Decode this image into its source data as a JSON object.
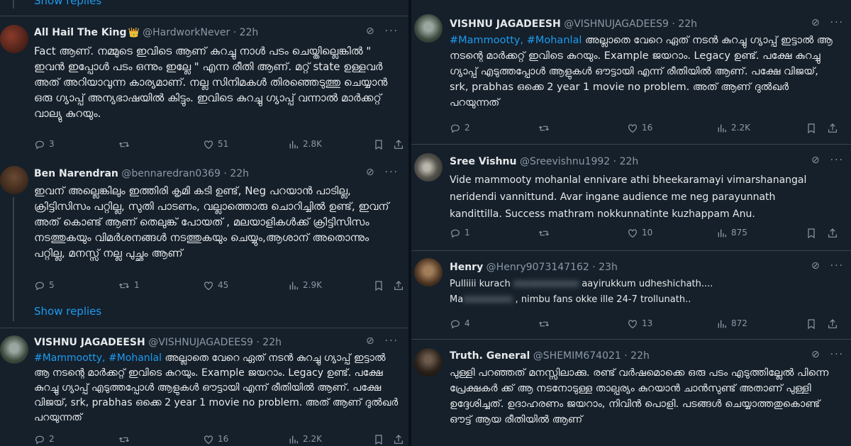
{
  "left": {
    "show_replies_top": "Show replies",
    "tweets": [
      {
        "name": "All Hail The King",
        "badge": "👑",
        "handle": "@HardworkNever",
        "time": "22h",
        "text": "Fact ആണ്. നമ്മുടെ ഇവിടെ ആണ് കുറച്ചു നാൾ പടം ചെയ്തില്ലെങ്കിൽ \" ഇവൻ ഇപ്പോൾ പടം ഒന്നും ഇല്ലേ \" എന്ന രീതി ആണ്. മറ്റ് state ഉള്ളവർ അത് അറിയാവുന്ന കാര്യമാണ്. നല്ല സിനിമകൾ തിരഞ്ഞെടുത്തു ചെയ്യാൻ ഒരു ഗ്യാപ്പ് അന്യഭാഷയിൽ കിട്ടും. ഇവിടെ കുറച്ചു ഗ്യാപ്പ് വന്നാൽ മാർക്കറ്റ് വാല്യു കുറയും.",
        "replies": "3",
        "retweets": "",
        "likes": "51",
        "views": "2.8K"
      },
      {
        "name": "Ben Narendran",
        "handle": "@bennaredran0369",
        "time": "22h",
        "text": "ഇവന് അല്ലെങ്കിലും ഇത്തിരി കൃമി കടി ഉണ്ട്, Neg പറയാൻ പാടില്ല, ക്രിട്ടിസിസം പറ്റില്ല, സുതി പാടണം, വല്ലാത്തൊരു ചൊറിച്ചിൽ ഉണ്ട്, ഇവന് അത് കൊണ്ട് ആണ് തെലുങ്ക് പോയത് , മലയാളികൾക്ക് ക്രിട്ടിസിസം നടത്തുകയും വിമർശനങ്ങൾ നടത്തുകയും ചെയ്യും,ആശാന് അതൊന്നും പറ്റില്ല, മനസ്സ് നല്ല പുച്ഛം ആണ്",
        "replies": "5",
        "retweets": "1",
        "likes": "45",
        "views": "2.9K"
      }
    ],
    "show_replies_bottom": "Show replies",
    "tweet3": {
      "name": "VISHNU JAGADEESH",
      "handle": "@VISHNUJAGADEES9",
      "time": "22h",
      "hashtags": "#Mammootty, #Mohanlal",
      "text": " അല്ലാതെ വേറെ ഏത് നടൻ കുറച്ചു ഗ്യാപ്പ് ഇട്ടാൽ ആ നടന്റെ മാർക്കറ്റ് ഇവിടെ കുറയും. Example ജയറാം. Legacy ഉണ്ട്. പക്ഷേ കുറച്ചു ഗ്യാപ്പ് എടുത്തപ്പോൾ ആളുകൾ ഔട്ടായി എന്ന് രീതിയിൽ ആണ്. പക്ഷേ വിജയ്, srk, prabhas ഒക്കെ 2 year 1 movie no problem. അത് ആണ് ദുൽഖർ പറയുന്നത്",
      "replies": "2",
      "retweets": "",
      "likes": "16",
      "views": "2.2K"
    }
  },
  "right": {
    "tweets": [
      {
        "name": "VISHNU JAGADEESH",
        "handle": "@VISHNUJAGADEES9",
        "time": "22h",
        "hashtags": "#Mammootty, #Mohanlal",
        "text": " അല്ലാതെ വേറെ ഏത് നടൻ കുറച്ചു ഗ്യാപ്പ് ഇട്ടാൽ ആ നടന്റെ മാർക്കറ്റ് ഇവിടെ കുറയും. Example ജയറാം. Legacy ഉണ്ട്. പക്ഷേ കുറച്ചു ഗ്യാപ്പ് എടുത്തപ്പോൾ ആളുകൾ ഔട്ടായി എന്ന് രീതിയിൽ ആണ്. പക്ഷേ വിജയ്, srk, prabhas ഒക്കെ 2 year 1 movie no problem. അത് ആണ് ദുൽഖർ പറയുന്നത്",
        "replies": "2",
        "retweets": "",
        "likes": "16",
        "views": "2.2K"
      },
      {
        "name": "Sree Vishnu",
        "handle": "@Sreevishnu1992",
        "time": "22h",
        "text": "Vide mammooty mohanlal ennivare athi bheekaramayi vimarshanangal neridendi vannittund. Avar ingane audience me neg parayunnath kandittilla. Success mathram nokkunnatinte kuzhappam Anu.",
        "replies": "1",
        "retweets": "",
        "likes": "10",
        "views": "875"
      },
      {
        "name": "Henry",
        "handle": "@Henry9073147162",
        "time": "23h",
        "text_a": "Pulliiii kurach",
        "text_blur1": "xxxxxxxxxxxx",
        "text_b": "aayirukkum udheshichath....",
        "text_c": "Ma",
        "text_blur2": "xxxxxxxxx",
        "text_d": ", nimbu fans okke ille 24-7 trollunath..",
        "replies": "4",
        "retweets": "",
        "likes": "13",
        "views": "872"
      },
      {
        "name": "Truth. General",
        "handle": "@SHEMIM674021",
        "time": "22h",
        "text": "പുള്ളി പറഞ്ഞത് മനസ്സിലാക്കു. രണ്ട് വർഷമൊക്കെ ഒരു പടം എടുത്തില്ലേൽ പിന്നെ പ്രേക്ഷകർ ക്ക് ആ നടനോടുള്ള താല്പര്യം കുറയാൻ ചാൻസുണ്ട് അതാണ് പുള്ളി ഉദ്ദേശിച്ചത്. ഉദാഹരണം ജയറാം, നിവിൻ പൊളി. പടങ്ങൾ ചെയ്യാത്തതുകൊണ്ട് ഔട്ട് ആയ രീതിയിൽ ആണ്"
      }
    ]
  },
  "icons": {
    "reply": "reply-icon",
    "retweet": "retweet-icon",
    "like": "heart-icon",
    "views": "views-icon",
    "bookmark": "bookmark-icon",
    "share": "share-icon",
    "grok": "grok-icon",
    "more": "more-icon"
  },
  "colors": {
    "background": "#15202b",
    "text": "#e7e9ea",
    "muted": "#8b98a5",
    "accent": "#1d9bf0",
    "divider": "#38444d"
  }
}
